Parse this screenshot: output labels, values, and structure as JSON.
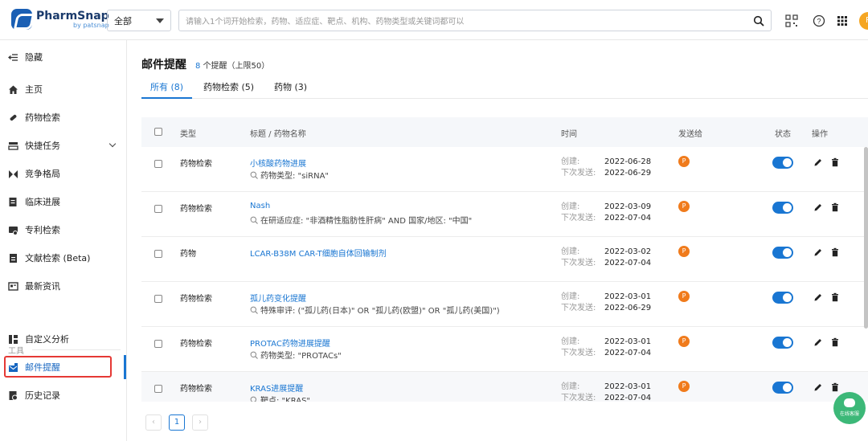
{
  "header": {
    "logo_name": "PharmSnap",
    "logo_sub": "by patsnap",
    "scope": "全部",
    "search_placeholder": "请输入1个词开始检索，药物、适应症、靶点、机构、药物类型或关键词都可以",
    "avatar": "P"
  },
  "sidebar": {
    "collapse": "隐藏",
    "items": [
      {
        "label": "主页",
        "icon": "home-icon"
      },
      {
        "label": "药物检索",
        "icon": "pill-icon"
      },
      {
        "label": "快捷任务",
        "icon": "task-icon"
      },
      {
        "label": "竞争格局",
        "icon": "landscape-icon"
      },
      {
        "label": "临床进展",
        "icon": "clinical-icon"
      },
      {
        "label": "专利检索",
        "icon": "patent-icon"
      },
      {
        "label": "文献检索 (Beta)",
        "icon": "literature-icon"
      },
      {
        "label": "最新资讯",
        "icon": "news-icon"
      }
    ],
    "section": "工具",
    "tools": [
      {
        "label": "自定义分析",
        "icon": "analysis-icon"
      },
      {
        "label": "邮件提醒",
        "icon": "mail-alert-icon"
      },
      {
        "label": "历史记录",
        "icon": "history-icon"
      }
    ]
  },
  "main": {
    "title": "邮件提醒",
    "count": "8",
    "count_suffix": "个提醒（上限50）",
    "tabs": [
      "所有 (8)",
      "药物检索 (5)",
      "药物 (3)"
    ],
    "columns": {
      "type": "类型",
      "title": "标题 / 药物名称",
      "time": "时间",
      "send": "发送给",
      "status": "状态",
      "action": "操作"
    },
    "created_label": "创建:",
    "next_label": "下次发送:",
    "rows": [
      {
        "type": "药物检索",
        "title": "小核酸药物进展",
        "sub": "药物类型: \"siRNA\"",
        "created": "2022-06-28",
        "next": "2022-06-29",
        "to": "P"
      },
      {
        "type": "药物检索",
        "title": "Nash",
        "sub": "在研适应症: \"非酒精性脂肪性肝病\" AND 国家/地区: \"中国\"",
        "created": "2022-03-09",
        "next": "2022-07-04",
        "to": "P"
      },
      {
        "type": "药物",
        "title": "LCAR-B38M CAR-T细胞自体回输制剂",
        "sub": "",
        "created": "2022-03-02",
        "next": "2022-07-04",
        "to": "P"
      },
      {
        "type": "药物检索",
        "title": "孤儿药变化提醒",
        "sub": "特殊审评: (\"孤儿药(日本)\" OR \"孤儿药(欧盟)\" OR \"孤儿药(美国)\")",
        "created": "2022-03-01",
        "next": "2022-06-29",
        "to": "P"
      },
      {
        "type": "药物检索",
        "title": "PROTAC药物进展提醒",
        "sub": "药物类型: \"PROTACs\"",
        "created": "2022-03-01",
        "next": "2022-07-04",
        "to": "P"
      },
      {
        "type": "药物检索",
        "title": "KRAS进展提醒",
        "sub": "靶点: \"KRAS\"",
        "created": "2022-03-01",
        "next": "2022-07-04",
        "to": "P"
      }
    ],
    "pager": {
      "prev": "‹",
      "current": "1",
      "next": "›"
    },
    "chat_label": "在线客服"
  }
}
